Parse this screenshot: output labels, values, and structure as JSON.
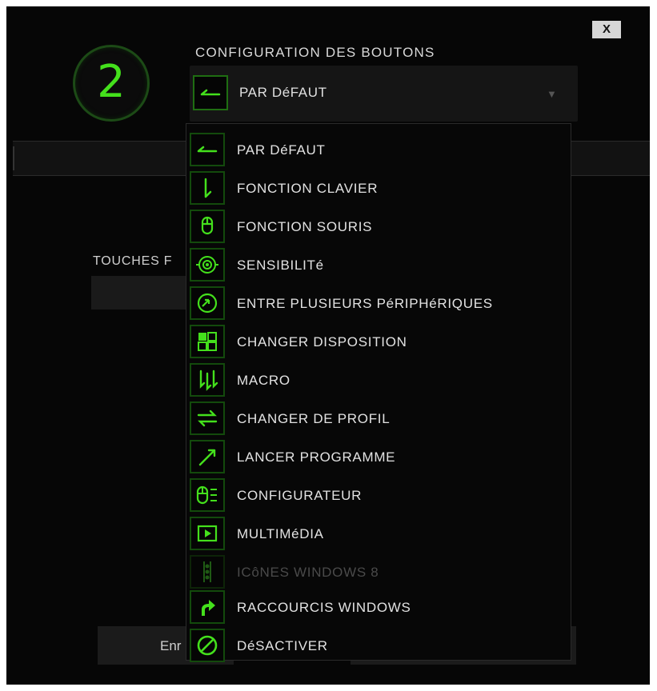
{
  "dialog": {
    "close_label": "X",
    "button_number": "2",
    "section_title": "CONFIGURATION DES BOUTONS",
    "selected_value": "PAR DéFAUT",
    "selected_icon": "arrow-left-icon",
    "caret_icon": "▼",
    "touches_label": "TOUCHES F",
    "bottom_left_label": "Enr"
  },
  "colors": {
    "accent": "#44e01c",
    "icon_border": "#134a0c",
    "background": "#060606",
    "text": "#e2e2e2",
    "disabled_text": "#4a4a4a"
  },
  "menu": {
    "items": [
      {
        "label": "PAR DéFAUT",
        "icon": "arrow-left-icon",
        "enabled": true
      },
      {
        "label": "FONCTION CLAVIER",
        "icon": "keyboard-key-icon",
        "enabled": true
      },
      {
        "label": "FONCTION SOURIS",
        "icon": "mouse-icon",
        "enabled": true
      },
      {
        "label": "SENSIBILITé",
        "icon": "target-icon",
        "enabled": true
      },
      {
        "label": "ENTRE PLUSIEURS PéRIPHéRIQUES",
        "icon": "inter-device-icon",
        "enabled": true
      },
      {
        "label": "CHANGER DISPOSITION",
        "icon": "layout-grid-icon",
        "enabled": true
      },
      {
        "label": "MACRO",
        "icon": "macro-icon",
        "enabled": true
      },
      {
        "label": "CHANGER DE PROFIL",
        "icon": "switch-arrows-icon",
        "enabled": true
      },
      {
        "label": "LANCER PROGRAMME",
        "icon": "launch-arrow-icon",
        "enabled": true
      },
      {
        "label": "CONFIGURATEUR",
        "icon": "mouse-config-icon",
        "enabled": true
      },
      {
        "label": "MULTIMéDIA",
        "icon": "play-icon",
        "enabled": true
      },
      {
        "label": "ICôNES WINDOWS 8",
        "icon": "windows8-charms-icon",
        "enabled": false
      },
      {
        "label": "RACCOURCIS WINDOWS",
        "icon": "shortcut-arrow-icon",
        "enabled": true
      },
      {
        "label": "DéSACTIVER",
        "icon": "disable-icon",
        "enabled": true
      }
    ]
  }
}
